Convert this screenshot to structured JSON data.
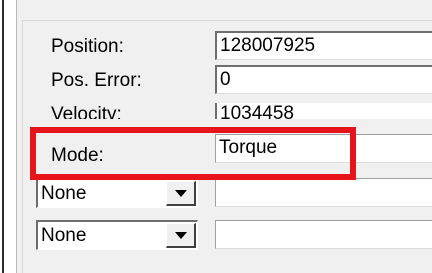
{
  "fields": [
    {
      "label": "Position:",
      "value": "128007925"
    },
    {
      "label": "Pos. Error:",
      "value": "0"
    },
    {
      "label": "Velocity:",
      "value": "1034458"
    },
    {
      "label": "Mode:",
      "value": "Torque"
    }
  ],
  "combos": [
    {
      "selected": "None",
      "value": ""
    },
    {
      "selected": "None",
      "value": ""
    }
  ],
  "highlight_color": "#e8141c",
  "icons": {
    "dropdown": "chevron-down-icon"
  }
}
